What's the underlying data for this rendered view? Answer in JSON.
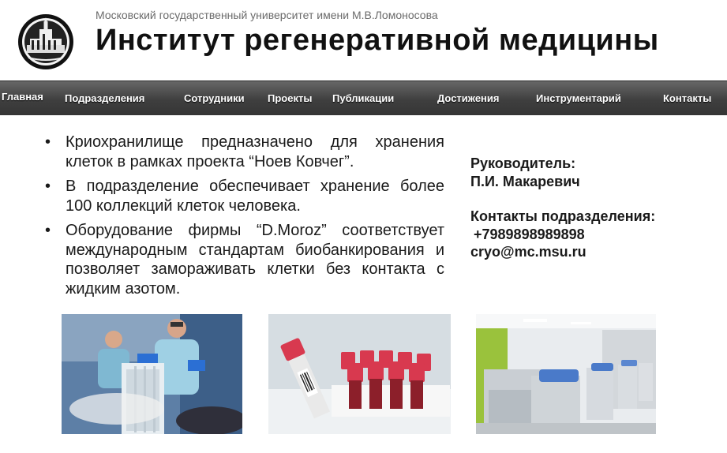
{
  "header": {
    "university": "Московский государственный университет имени М.В.Ломоносова",
    "institute": "Институт регенеративной медицины"
  },
  "nav": {
    "items": [
      {
        "label": "Главная"
      },
      {
        "label": "Подразделения"
      },
      {
        "label": "Сотрудники"
      },
      {
        "label": "Проекты"
      },
      {
        "label": "Публикации"
      },
      {
        "label": "Достижения"
      },
      {
        "label": "Инструментарий"
      },
      {
        "label": "Контакты"
      }
    ],
    "active": "Главная"
  },
  "content": {
    "bullets": [
      "Криохранилище предназначено для хранения клеток в рамках проекта “Ноев Ковчег”.",
      "В подразделение обеспечивает хранение более 100 коллекций клеток человека.",
      "Оборудование фирмы “D.Moroz” соответствует международным стандартам биобанкирования и позволяет замораживать клетки без контакта с жидким азотом."
    ]
  },
  "sidebar": {
    "head_label": "Руководитель:",
    "head_name": "П.И. Макаревич",
    "contacts_label": "Контакты подразделения:",
    "phone": "+7989898989898",
    "email": "cryo@mc.msu.ru"
  },
  "icons": {
    "logo": "msu-logo-icon"
  },
  "colors": {
    "nav_bg": "#3f3f3f",
    "nav_text": "#ffffff",
    "tube_cap": "#d8394f"
  }
}
